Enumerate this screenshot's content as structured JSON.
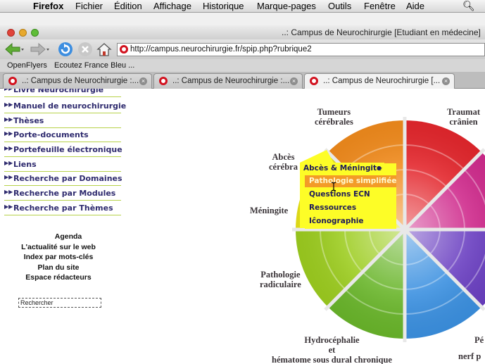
{
  "menubar": {
    "app": "Firefox",
    "items": [
      "Fichier",
      "Édition",
      "Affichage",
      "Historique",
      "Marque-pages",
      "Outils",
      "Fenêtre",
      "Aide"
    ]
  },
  "window": {
    "title": "..: Campus de Neurochirurgie [Etudiant en médecine]"
  },
  "toolbar": {
    "url": "http://campus.neurochirurgie.fr/spip.php?rubrique2"
  },
  "bookmarks": [
    "OpenFlyers",
    "Ecoutez France Bleu ..."
  ],
  "tabs": [
    {
      "label": "..: Campus de Neurochirurgie :...",
      "active": false
    },
    {
      "label": "..: Campus de Neurochirurgie :...",
      "active": false
    },
    {
      "label": "..: Campus de Neurochirurgie [...",
      "active": true
    }
  ],
  "sidebar": {
    "partial_top": "Livre Neurochirurgie",
    "items": [
      "Manuel de neurochirurgie",
      "Thèses",
      "Porte-documents",
      "Portefeuille électronique",
      "Liens",
      "Recherche par Domaines",
      "Recherche par Modules",
      "Recherche par Thèmes"
    ],
    "links": [
      "Agenda",
      "L'actualité sur le web",
      "Index par mots-clés",
      "Plan du site",
      "Espace rédacteurs"
    ],
    "search_placeholder": "Rechercher"
  },
  "wheel": {
    "labels": {
      "tumeurs": "Tumeurs\ncérébrales",
      "trauma": "Traumat\ncrânien",
      "abces": "Abcès\ncérébra",
      "meningite": "Méningite",
      "pathologie": "Pathologie\nradiculaire",
      "hydro": "Hydrocéphalie\net\nhématome sous dural chronique",
      "pe": "Pé",
      "nerf": "nerf p"
    },
    "colors": {
      "orange": "#f08a1c",
      "red": "#e3262c",
      "magenta": "#cf2a8c",
      "purple": "#8f3aa8",
      "blue": "#2f5fd6",
      "lightblue": "#3b90e0",
      "green": "#69b52a",
      "lime": "#9ccc1f"
    }
  },
  "popup": {
    "parent": "Abcès & Méningite",
    "items": [
      "Pathologie simplifiée",
      "Questions ECN",
      "Ressources",
      "Iĉonographie"
    ],
    "highlighted_index": 0
  }
}
